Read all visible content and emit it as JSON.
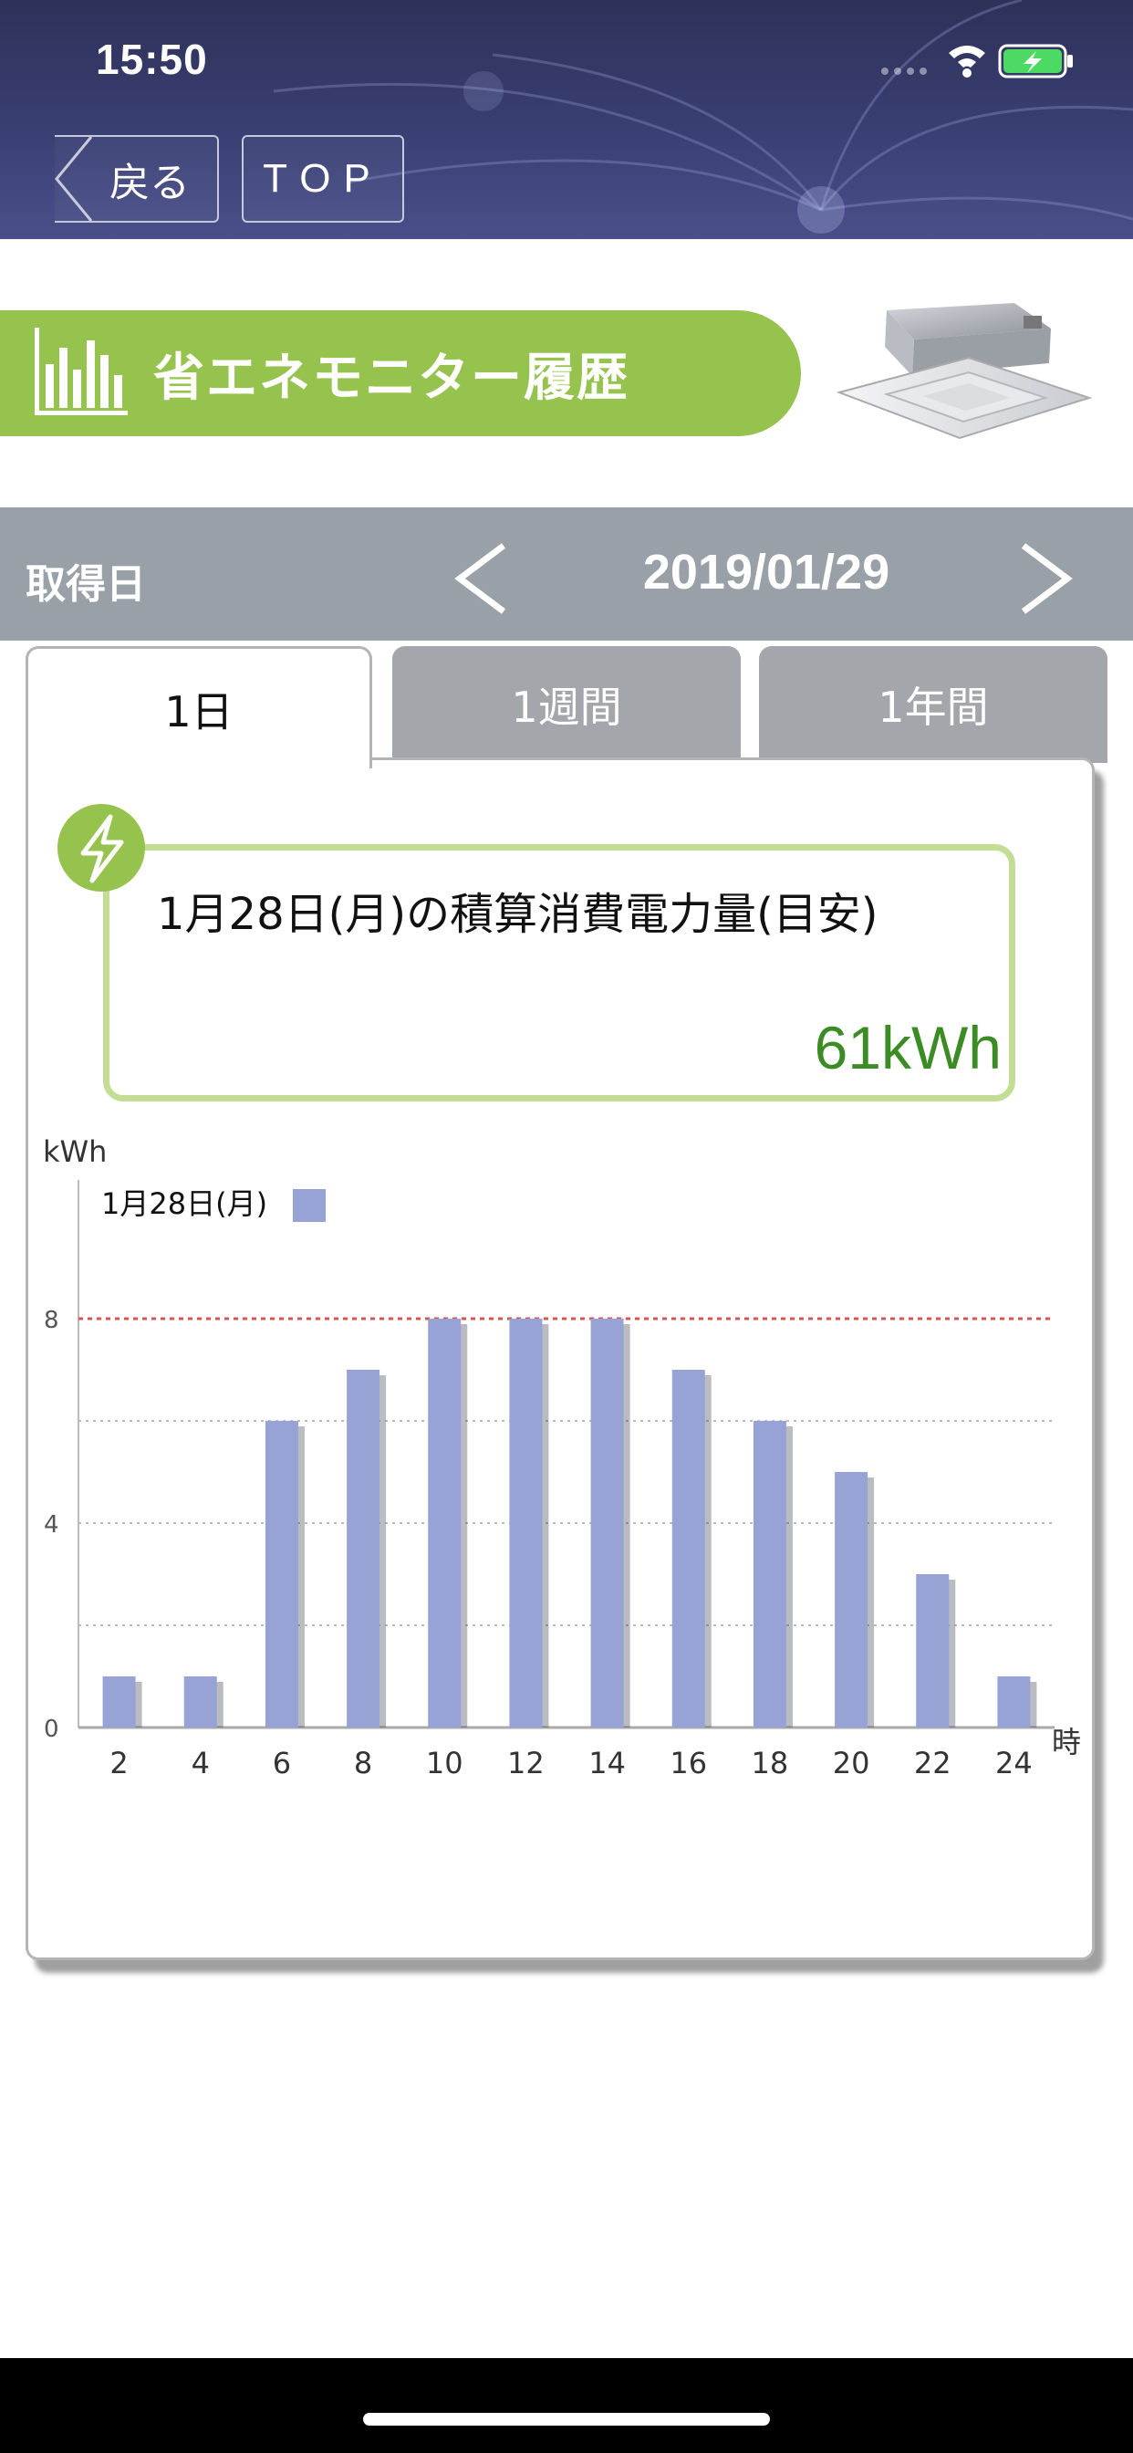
{
  "status": {
    "time": "15:50"
  },
  "nav": {
    "back_label": "戻る",
    "top_label": "TOP"
  },
  "title": {
    "text": "省エネモニター履歴"
  },
  "datebar": {
    "label": "取得日",
    "date": "2019/01/29"
  },
  "tabs": [
    {
      "label": "1日",
      "active": true
    },
    {
      "label": "1週間",
      "active": false
    },
    {
      "label": "1年間",
      "active": false
    }
  ],
  "summary": {
    "label": "1月28日(月)の積算消費電力量(目安)",
    "value": "61kWh"
  },
  "colors": {
    "accent": "#96c24e",
    "value": "#3b8c24",
    "bar": "#96a3d4",
    "limit_line": "#d9534f"
  },
  "chart_data": {
    "type": "bar",
    "ylabel": "kWh",
    "xlabel": "時",
    "legend": "1月28日(月)",
    "categories": [
      "2",
      "4",
      "6",
      "8",
      "10",
      "12",
      "14",
      "16",
      "18",
      "20",
      "22",
      "24"
    ],
    "series": [
      {
        "name": "1月28日(月)",
        "values": [
          1,
          1,
          6,
          7,
          8,
          8,
          8,
          7,
          6,
          5,
          3,
          1
        ]
      }
    ],
    "yticks": [
      "0",
      "4",
      "8"
    ],
    "ylim": [
      0,
      10
    ],
    "reference_line": 8,
    "grid": true
  }
}
